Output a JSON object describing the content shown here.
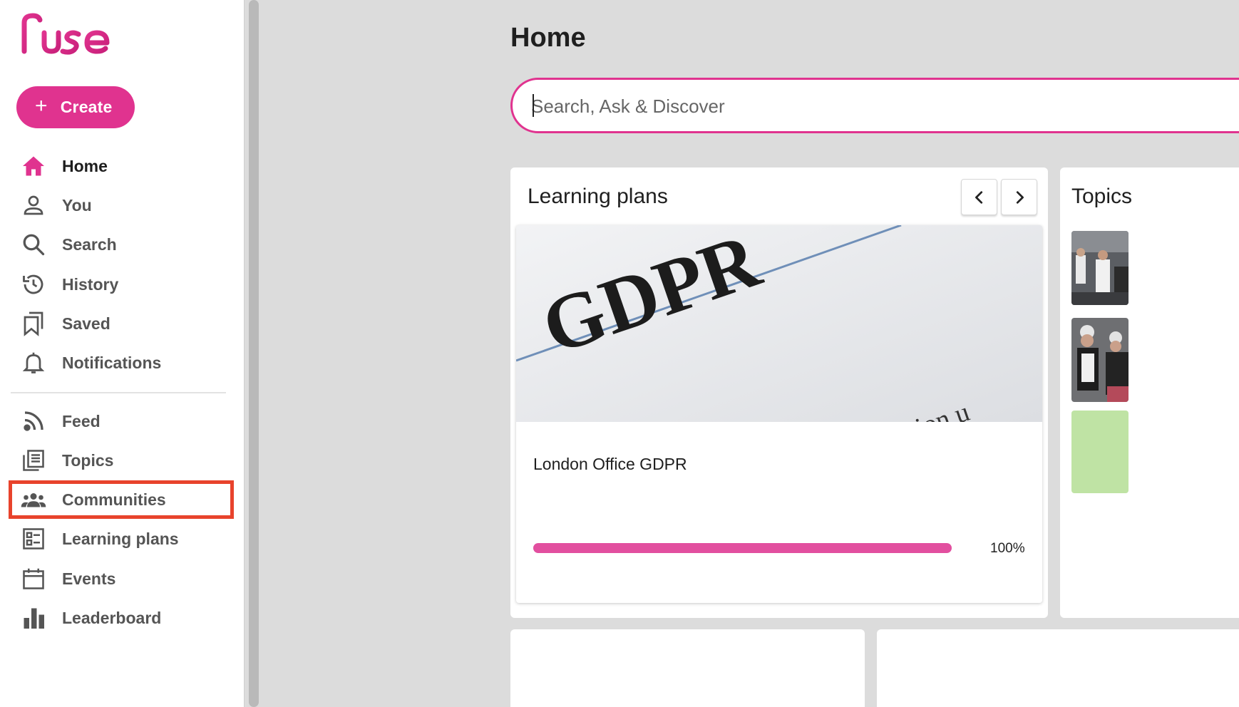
{
  "app": {
    "logo_text": "Fuse",
    "brand_color": "#e0338f"
  },
  "sidebar": {
    "create_label": "Create",
    "primary_nav": [
      {
        "label": "Home",
        "icon": "home-icon",
        "active": true
      },
      {
        "label": "You",
        "icon": "person-icon"
      },
      {
        "label": "Search",
        "icon": "search-icon"
      },
      {
        "label": "History",
        "icon": "history-icon"
      },
      {
        "label": "Saved",
        "icon": "bookmark-icon"
      },
      {
        "label": "Notifications",
        "icon": "bell-icon"
      }
    ],
    "secondary_nav": [
      {
        "label": "Feed",
        "icon": "rss-icon"
      },
      {
        "label": "Topics",
        "icon": "topics-icon"
      },
      {
        "label": "Communities",
        "icon": "group-icon",
        "highlighted": true,
        "highlight_color": "#e8432c"
      },
      {
        "label": "Learning plans",
        "icon": "checklist-icon"
      },
      {
        "label": "Events",
        "icon": "calendar-icon"
      },
      {
        "label": "Leaderboard",
        "icon": "bar-chart-icon"
      }
    ]
  },
  "main": {
    "title": "Home",
    "search": {
      "placeholder": "Search, Ask & Discover",
      "value": ""
    },
    "learning_plans": {
      "title": "Learning plans",
      "items": [
        {
          "name": "London Office GDPR",
          "progress_percent": 100,
          "progress_label": "100%",
          "progress_color": "#e24f9f"
        }
      ]
    },
    "topics": {
      "title": "Topics"
    }
  }
}
